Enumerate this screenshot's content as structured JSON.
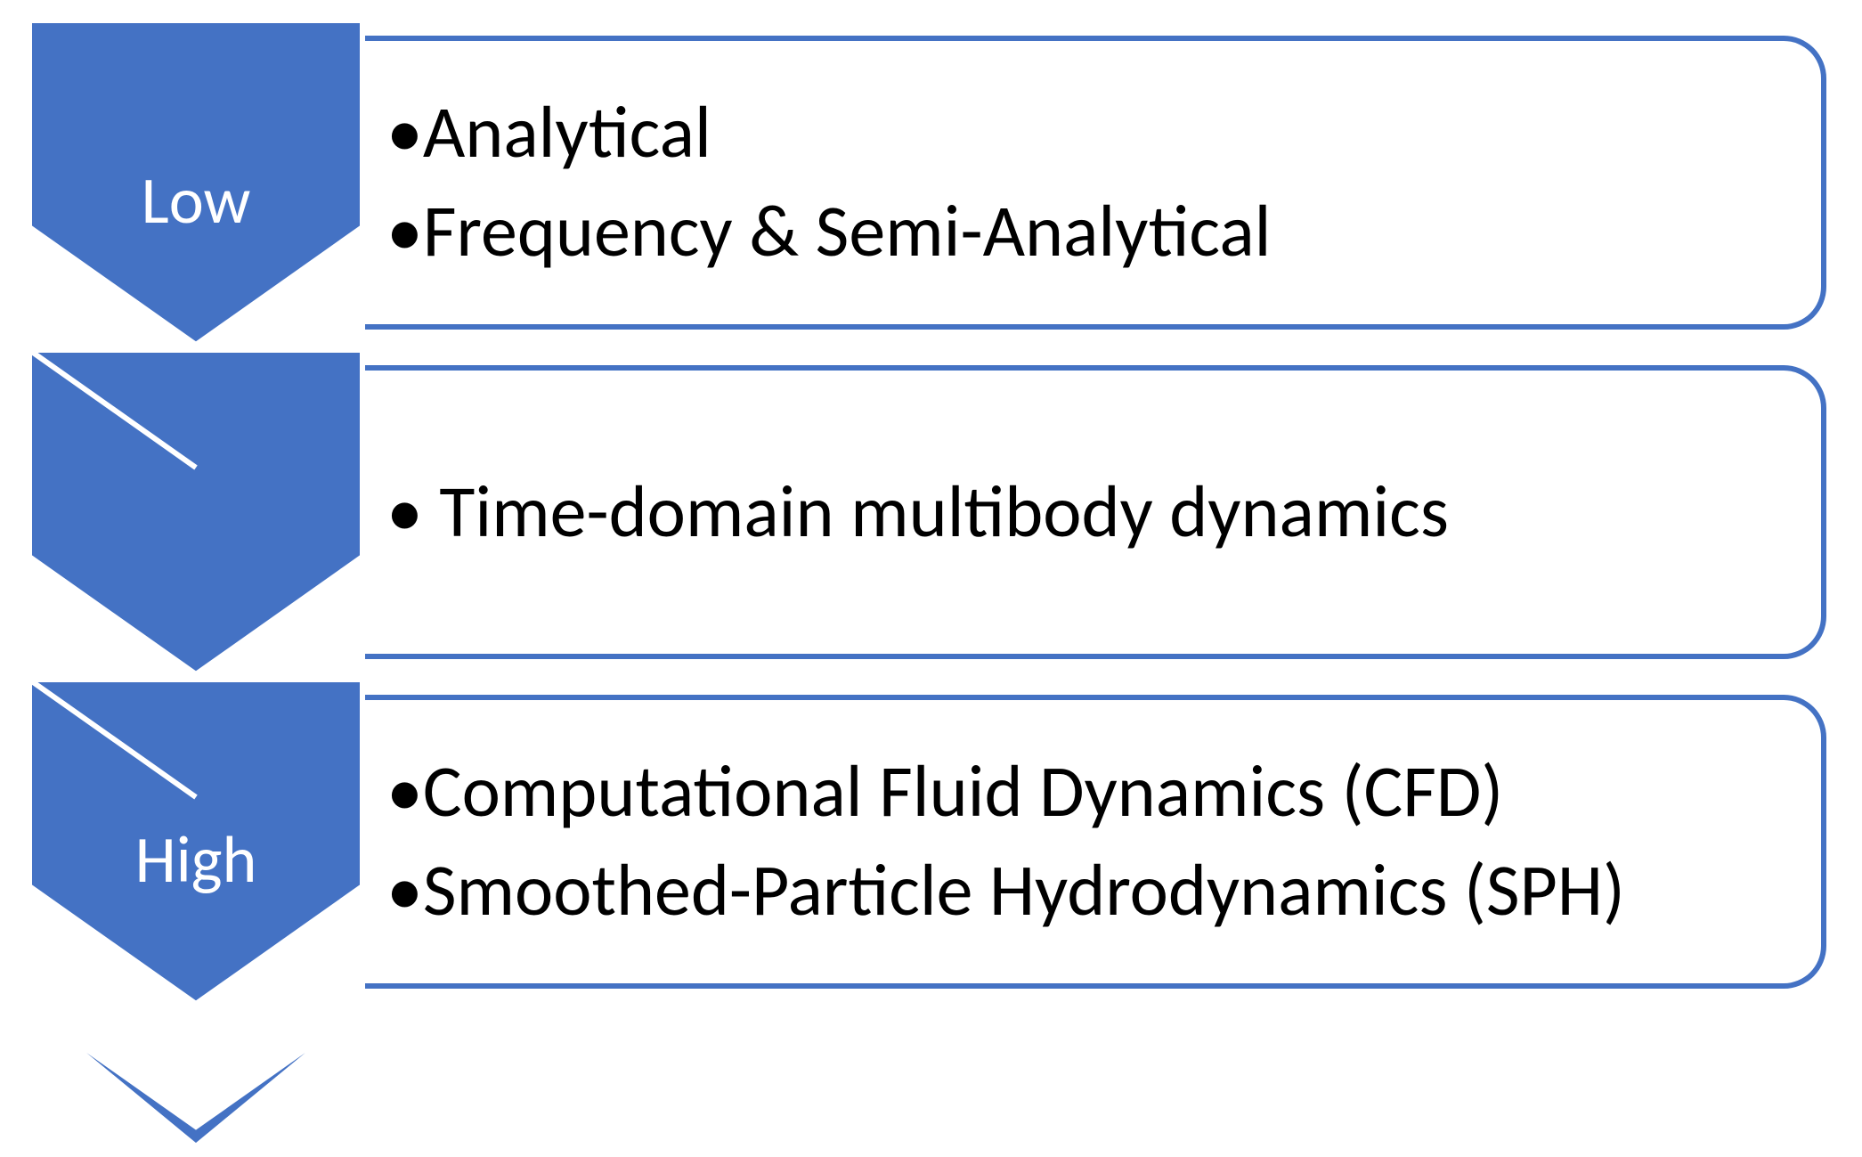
{
  "diagram": {
    "color_fill": "#4472C4",
    "color_stroke_white": "#FFFFFF",
    "rows": [
      {
        "label": "Low",
        "items": [
          "•Analytical",
          "•Frequency & Semi-Analytical"
        ]
      },
      {
        "label": "",
        "items": [
          "• Time-domain multibody dynamics"
        ]
      },
      {
        "label": "High",
        "items": [
          "•Computational Fluid Dynamics (CFD)",
          "•Smoothed-Particle Hydrodynamics (SPH)"
        ]
      }
    ]
  }
}
